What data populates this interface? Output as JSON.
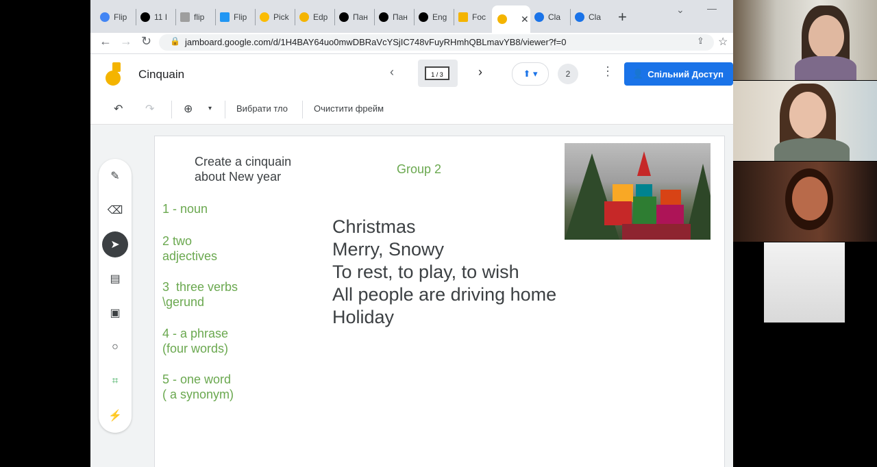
{
  "browser": {
    "tabs": [
      {
        "label": "Flip",
        "color": "#4285f4"
      },
      {
        "label": "11 I",
        "color": "#000000"
      },
      {
        "label": "flip",
        "color": "#9e9e9e"
      },
      {
        "label": "Flip",
        "color": "#2196f3"
      },
      {
        "label": "Pick",
        "color": "#fbbc04"
      },
      {
        "label": "Edp",
        "color": "#f4b400"
      },
      {
        "label": "Пан",
        "color": "#000000"
      },
      {
        "label": "Пан",
        "color": "#000000"
      },
      {
        "label": "Eng",
        "color": "#000000"
      },
      {
        "label": "Foc",
        "color": "#f4b400"
      },
      {
        "label": "",
        "color": "#f4b400"
      },
      {
        "label": "Cla",
        "color": "#1a73e8"
      },
      {
        "label": "Cla",
        "color": "#1a73e8"
      }
    ],
    "url": "jamboard.google.com/d/1H4BAY64uo0mwDBRaVcYSjIC748vFuyRHmhQBLmavYB8/viewer?f=0"
  },
  "jamboard": {
    "title": "Cinquain",
    "frame_indicator": "1 / 3",
    "viewer_count": "2",
    "share_label": "Спільний Доступ",
    "toolbar": {
      "set_background": "Вибрати тло",
      "clear_frame": "Очистити фрейм"
    }
  },
  "frame": {
    "instructions": [
      "Create a cinquain",
      "about New year"
    ],
    "group": "Group 2",
    "rules": [
      [
        "1 - noun"
      ],
      [
        "2 two",
        "adjectives"
      ],
      [
        "3  three verbs",
        "\\gerund"
      ],
      [
        "4 - a phrase",
        "(four words)"
      ],
      [
        "5 - one word",
        "( a synonym)"
      ]
    ],
    "poem": [
      "Christmas",
      "Merry, Snowy",
      "To rest, to play, to wish",
      "All people are driving home",
      "Holiday"
    ]
  },
  "colors": {
    "accent": "#1a73e8",
    "rule_text": "#6aa84f",
    "poem_text": "#3c4043"
  }
}
